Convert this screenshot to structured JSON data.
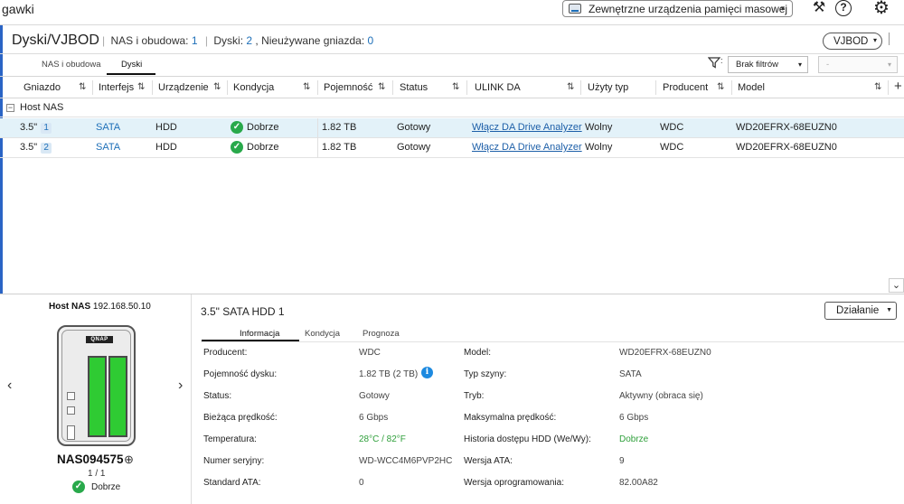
{
  "topbar": {
    "app_title": "gawki",
    "external_dropdown": "Zewnętrzne urządzenia pamięci masowej",
    "icons": [
      "tools-icon",
      "help-icon",
      "gear-icon"
    ],
    "help_glyph": "?"
  },
  "header": {
    "title": "Dyski/VJBOD",
    "nas_label": "NAS i obudowa:",
    "nas_count": "1",
    "disks_label": "Dyski:",
    "disks_count": "2",
    "unused_label": ", Nieużywane gniazda:",
    "unused_count": "0",
    "vjbod_button": "VJBOD"
  },
  "tabs": {
    "nas_tab": "NAS i obudowa",
    "disks_tab": "Dyski",
    "filter_value": "Brak filtrów",
    "filter2_value": "-",
    "filter_suffix": ":"
  },
  "table": {
    "columns": [
      "Gniazdo",
      "Interfejs",
      "Urządzenie",
      "Kondycja",
      "Pojemność",
      "Status",
      "ULINK DA",
      "Użyty typ",
      "Producent",
      "Model"
    ],
    "group": "Host NAS",
    "rows": [
      {
        "slot": "3.5\"",
        "slot_num": "1",
        "interface": "SATA",
        "device": "HDD",
        "health": "Dobrze",
        "capacity": "1.82 TB",
        "status": "Gotowy",
        "ulink": "Włącz DA Drive Analyzer",
        "used_type": "Wolny",
        "vendor": "WDC",
        "model": "WD20EFRX-68EUZN0",
        "selected": true
      },
      {
        "slot": "3.5\"",
        "slot_num": "2",
        "interface": "SATA",
        "device": "HDD",
        "health": "Dobrze",
        "capacity": "1.82 TB",
        "status": "Gotowy",
        "ulink": "Włącz DA Drive Analyzer",
        "used_type": "Wolny",
        "vendor": "WDC",
        "model": "WD20EFRX-68EUZN0",
        "selected": false
      }
    ]
  },
  "left_panel": {
    "host_label": "Host NAS",
    "host_ip": "192.168.50.10",
    "nas_logo": "QNAP",
    "nas_name": "NAS094575",
    "count": "1 / 1",
    "health": "Dobrze"
  },
  "detail": {
    "title": "3.5\" SATA HDD 1",
    "action_button": "Działanie",
    "tabs": [
      "Informacja",
      "Kondycja",
      "Prognoza"
    ],
    "left": [
      {
        "label": "Producent:",
        "value": "WDC"
      },
      {
        "label": "Pojemność dysku:",
        "value": "1.82 TB (2 TB)"
      },
      {
        "label": "Status:",
        "value": "Gotowy"
      },
      {
        "label": "Bieżąca prędkość:",
        "value": "6 Gbps"
      },
      {
        "label": "Temperatura:",
        "value": "28°C / 82°F"
      },
      {
        "label": "Numer seryjny:",
        "value": "WD-WCC4M6PVP2HC"
      },
      {
        "label": "Standard ATA:",
        "value": "0"
      }
    ],
    "right": [
      {
        "label": "Model:",
        "value": "WD20EFRX-68EUZN0"
      },
      {
        "label": "Typ szyny:",
        "value": "SATA"
      },
      {
        "label": "Tryb:",
        "value": "Aktywny (obraca się)"
      },
      {
        "label": "Maksymalna prędkość:",
        "value": "6 Gbps"
      },
      {
        "label": "Historia dostępu HDD (We/Wy):",
        "value": "Dobrze"
      },
      {
        "label": "Wersja ATA:",
        "value": "9"
      },
      {
        "label": "Wersja oprogramowania:",
        "value": "82.00A82"
      }
    ],
    "info_glyph": "i"
  },
  "colors": {
    "accent": "#1d6fb8",
    "ok_green": "#29a94b",
    "bay_green": "#2fcb33",
    "selected_row": "#e3f2f9"
  }
}
